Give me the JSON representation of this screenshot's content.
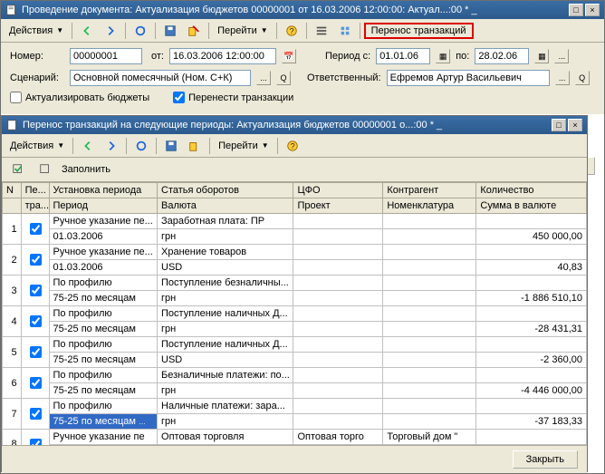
{
  "main_window": {
    "title": "Проведение документа: Актуализация бюджетов 00000001 от 16.03.2006 12:00:00: Актуал...:00 * _"
  },
  "main_toolbar": {
    "actions": "Действия",
    "goto": "Перейти",
    "transfer": "Перенос транзакций"
  },
  "form": {
    "number_label": "Номер:",
    "number": "00000001",
    "from_label": "от:",
    "from": "16.03.2006 12:00:00",
    "period_from_label": "Период с:",
    "period_from": "01.01.06",
    "period_to_label": "по:",
    "period_to": "28.02.06",
    "scenario_label": "Сценарий:",
    "scenario": "Основной помесячный (Ном. С+К)",
    "responsible_label": "Ответственный:",
    "responsible": "Ефремов Артур Васильевич",
    "chk_actualize": "Актуализировать бюджеты",
    "chk_transfer": "Перенести транзакции"
  },
  "sub_window": {
    "title": "Перенос транзакций на следующие периоды: Актуализация бюджетов 00000001   о...:00 * _"
  },
  "sub_toolbar": {
    "actions": "Действия",
    "goto": "Перейти"
  },
  "grid_toolbar": {
    "fill": "Заполнить"
  },
  "grid": {
    "headers1": {
      "n": "N",
      "flag": "Пе...",
      "setting": "Установка периода",
      "article": "Статья оборотов",
      "cfo": "ЦФО",
      "contragent": "Контрагент",
      "qty": "Количество"
    },
    "headers2": {
      "n": "",
      "flag": "тра...",
      "setting": "Период",
      "article": "Валюта",
      "cfo": "Проект",
      "contragent": "Номенклатура",
      "qty": "Сумма в валюте"
    },
    "rows": [
      {
        "n": "1",
        "chk": true,
        "setting1": "Ручное указание пе...",
        "setting2": "01.03.2006",
        "article1": "Заработная плата: ПР",
        "article2": "грн",
        "cfo1": "",
        "cfo2": "",
        "cont1": "",
        "cont2": "",
        "qty1": "",
        "qty2": "450 000,00"
      },
      {
        "n": "2",
        "chk": true,
        "setting1": "Ручное указание пе...",
        "setting2": "01.03.2006",
        "article1": "Хранение товаров",
        "article2": "USD",
        "cfo1": "",
        "cfo2": "",
        "cont1": "",
        "cont2": "",
        "qty1": "",
        "qty2": "40,83"
      },
      {
        "n": "3",
        "chk": true,
        "setting1": "По профилю",
        "setting2": "75-25 по месяцам",
        "article1": "Поступление безналичны...",
        "article2": "грн",
        "cfo1": "",
        "cfo2": "",
        "cont1": "",
        "cont2": "",
        "qty1": "",
        "qty2": "-1 886 510,10"
      },
      {
        "n": "4",
        "chk": true,
        "setting1": "По профилю",
        "setting2": "75-25 по месяцам",
        "article1": "Поступление наличных Д...",
        "article2": "грн",
        "cfo1": "",
        "cfo2": "",
        "cont1": "",
        "cont2": "",
        "qty1": "",
        "qty2": "-28 431,31"
      },
      {
        "n": "5",
        "chk": true,
        "setting1": "По профилю",
        "setting2": "75-25 по месяцам",
        "article1": "Поступление наличных Д...",
        "article2": "USD",
        "cfo1": "",
        "cfo2": "",
        "cont1": "",
        "cont2": "",
        "qty1": "",
        "qty2": "-2 360,00"
      },
      {
        "n": "6",
        "chk": true,
        "setting1": "По профилю",
        "setting2": "75-25 по месяцам",
        "article1": "Безналичные платежи: по...",
        "article2": "грн",
        "cfo1": "",
        "cfo2": "",
        "cont1": "",
        "cont2": "",
        "qty1": "",
        "qty2": "-4 446 000,00"
      },
      {
        "n": "7",
        "chk": true,
        "setting1": "По профилю",
        "setting2": "75-25 по месяцам",
        "article1": "Наличные платежи: зара...",
        "article2": "грн",
        "cfo1": "",
        "cfo2": "",
        "cont1": "",
        "cont2": "",
        "qty1": "",
        "qty2": "-37 183,33",
        "selected": true
      },
      {
        "n": "8",
        "chk": true,
        "setting1": "Ручное указание пе",
        "setting2": "",
        "article1": "Оптовая торговля",
        "article2": "",
        "cfo1": "Оптовая торго",
        "cfo2": "",
        "cont1": "Торговый дом \"",
        "cont2": "",
        "qty1": "",
        "qty2": ""
      }
    ]
  },
  "footer": {
    "close": "Закрыть",
    "close2": "рыть"
  }
}
